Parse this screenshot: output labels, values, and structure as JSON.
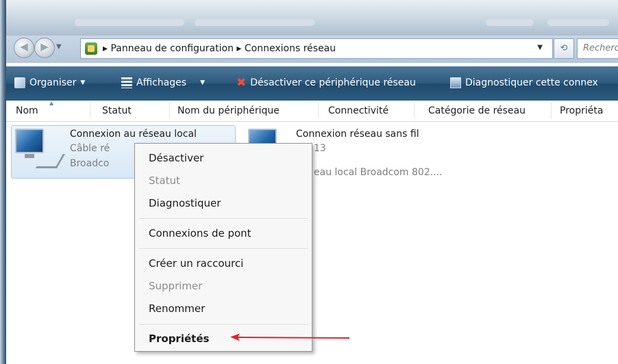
{
  "address": {
    "path_root": "Panneau de configuration",
    "path_current": "Connexions réseau",
    "separator": "▸",
    "refresh_glyph": "⁴⁄₇",
    "search_placeholder": "Recherch"
  },
  "toolbar": {
    "organize": "Organiser",
    "views": "Affichages",
    "disable": "Désactiver ce périphérique réseau",
    "diagnose": "Diagnostiquer cette connex"
  },
  "columns": [
    "Nom",
    "Statut",
    "Nom du périphérique",
    "Connectivité",
    "Catégorie de réseau",
    "Propriéta"
  ],
  "items": [
    {
      "title": "Connexion au réseau local",
      "line1": "Câble ré",
      "line2": "Broadco"
    },
    {
      "title": "Connexion réseau sans fil",
      "line1": "13",
      "line2": "eau local Broadcom 802...."
    }
  ],
  "context_menu": {
    "disable": "Désactiver",
    "status": "Statut",
    "diagnose": "Diagnostiquer",
    "bridge": "Connexions de pont",
    "shortcut": "Créer un raccourci",
    "delete": "Supprimer",
    "rename": "Renommer",
    "properties": "Propriétés"
  },
  "colors": {
    "toolbar": "#2b597c",
    "selection": "#d8e8f6",
    "arrow": "#e0242b"
  }
}
